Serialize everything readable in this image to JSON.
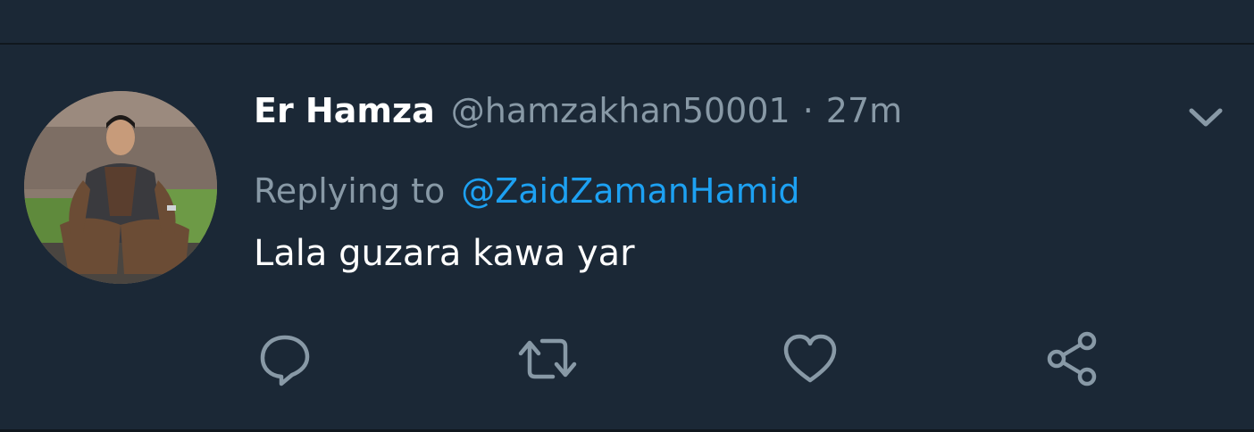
{
  "tweet": {
    "display_name": "Er Hamza",
    "handle": "@hamzakhan50001",
    "separator": "·",
    "timestamp": "27m",
    "reply_prefix": "Replying to",
    "reply_to": "@ZaidZamanHamid",
    "text": "Lala guzara kawa yar"
  },
  "icons": {
    "menu": "chevron-down-icon",
    "reply": "reply-bubble-icon",
    "retweet": "retweet-icon",
    "like": "heart-icon",
    "share": "share-icon"
  },
  "colors": {
    "background": "#1b2836",
    "divider": "#10171e",
    "primary_text": "#ffffff",
    "secondary_text": "#8899a6",
    "link": "#1da1f2"
  }
}
